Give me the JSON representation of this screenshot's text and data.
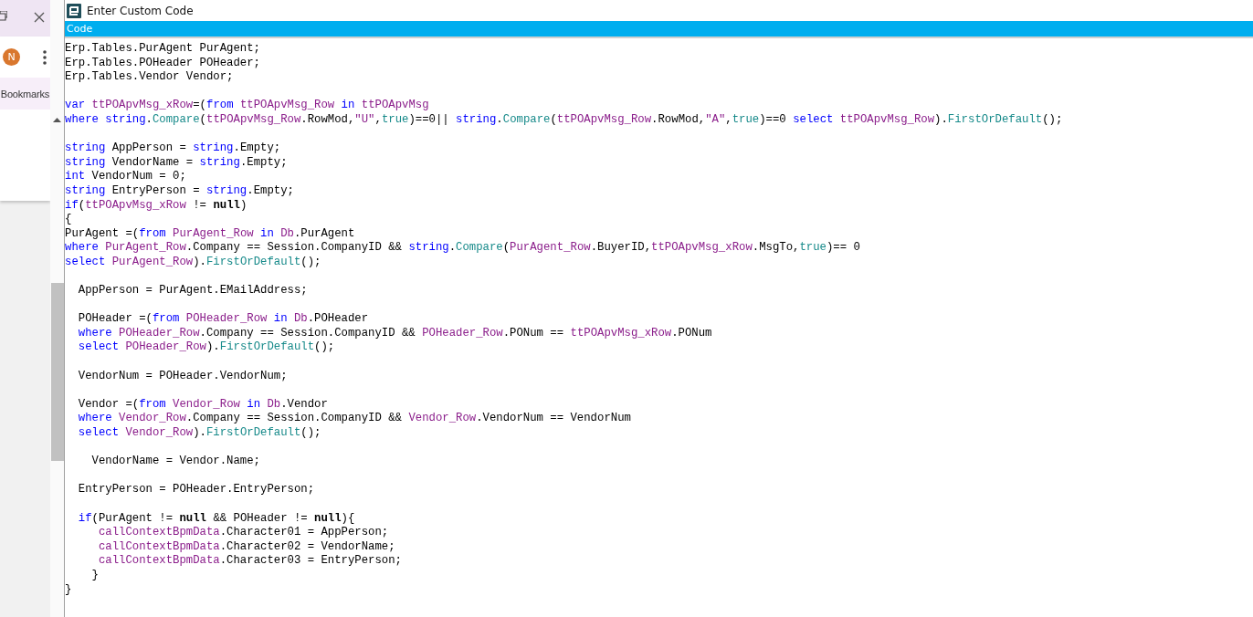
{
  "browser": {
    "avatar": "N",
    "bookmarks_label": "Bookmarks"
  },
  "window": {
    "title": "Enter Custom Code",
    "section": "Code"
  },
  "code_lines": [
    {
      "kind": "code",
      "tokens": [
        {
          "kind": "plain",
          "text": "Erp.Tables.PurAgent PurAgent;"
        }
      ]
    },
    {
      "kind": "code",
      "tokens": [
        {
          "kind": "plain",
          "text": "Erp.Tables.POHeader POHeader;"
        }
      ]
    },
    {
      "kind": "code",
      "tokens": [
        {
          "kind": "plain",
          "text": "Erp.Tables.Vendor Vendor;"
        }
      ]
    },
    {
      "kind": "blank"
    },
    {
      "kind": "code",
      "tokens": [
        {
          "kind": "keyword",
          "text": "var "
        },
        {
          "kind": "variable",
          "text": "ttPOApvMsg_xRow"
        },
        {
          "kind": "plain",
          "text": "=("
        },
        {
          "kind": "keyword",
          "text": "from "
        },
        {
          "kind": "variable",
          "text": "ttPOApvMsg_Row "
        },
        {
          "kind": "keyword",
          "text": "in "
        },
        {
          "kind": "variable",
          "text": "ttPOApvMsg"
        }
      ]
    },
    {
      "kind": "code",
      "tokens": [
        {
          "kind": "keyword",
          "text": "where string"
        },
        {
          "kind": "plain",
          "text": "."
        },
        {
          "kind": "method",
          "text": "Compare"
        },
        {
          "kind": "plain",
          "text": "("
        },
        {
          "kind": "variable",
          "text": "ttPOApvMsg_Row"
        },
        {
          "kind": "plain",
          "text": ".RowMod,"
        },
        {
          "kind": "variable",
          "text": "\"U\""
        },
        {
          "kind": "plain",
          "text": ","
        },
        {
          "kind": "method",
          "text": "true"
        },
        {
          "kind": "plain",
          "text": ")==0|| "
        },
        {
          "kind": "keyword",
          "text": "string"
        },
        {
          "kind": "plain",
          "text": "."
        },
        {
          "kind": "method",
          "text": "Compare"
        },
        {
          "kind": "plain",
          "text": "("
        },
        {
          "kind": "variable",
          "text": "ttPOApvMsg_Row"
        },
        {
          "kind": "plain",
          "text": ".RowMod,"
        },
        {
          "kind": "variable",
          "text": "\"A\""
        },
        {
          "kind": "plain",
          "text": ","
        },
        {
          "kind": "method",
          "text": "true"
        },
        {
          "kind": "plain",
          "text": ")==0 "
        },
        {
          "kind": "keyword",
          "text": "select "
        },
        {
          "kind": "variable",
          "text": "ttPOApvMsg_Row"
        },
        {
          "kind": "plain",
          "text": ")."
        },
        {
          "kind": "method",
          "text": "FirstOrDefault"
        },
        {
          "kind": "plain",
          "text": "();"
        }
      ]
    },
    {
      "kind": "blank"
    },
    {
      "kind": "code",
      "tokens": [
        {
          "kind": "keyword",
          "text": "string "
        },
        {
          "kind": "plain",
          "text": "AppPerson = "
        },
        {
          "kind": "keyword",
          "text": "string"
        },
        {
          "kind": "plain",
          "text": ".Empty;"
        }
      ]
    },
    {
      "kind": "code",
      "tokens": [
        {
          "kind": "keyword",
          "text": "string "
        },
        {
          "kind": "plain",
          "text": "VendorName = "
        },
        {
          "kind": "keyword",
          "text": "string"
        },
        {
          "kind": "plain",
          "text": ".Empty;"
        }
      ]
    },
    {
      "kind": "code",
      "tokens": [
        {
          "kind": "keyword",
          "text": "int "
        },
        {
          "kind": "plain",
          "text": "VendorNum = 0;"
        }
      ]
    },
    {
      "kind": "code",
      "tokens": [
        {
          "kind": "keyword",
          "text": "string "
        },
        {
          "kind": "plain",
          "text": "EntryPerson = "
        },
        {
          "kind": "keyword",
          "text": "string"
        },
        {
          "kind": "plain",
          "text": ".Empty;"
        }
      ]
    },
    {
      "kind": "code",
      "tokens": [
        {
          "kind": "keyword",
          "text": "if"
        },
        {
          "kind": "plain",
          "text": "("
        },
        {
          "kind": "variable",
          "text": "ttPOApvMsg_xRow"
        },
        {
          "kind": "plain",
          "text": " != "
        },
        {
          "kind": "bold",
          "text": "null"
        },
        {
          "kind": "plain",
          "text": ")"
        }
      ]
    },
    {
      "kind": "code",
      "tokens": [
        {
          "kind": "plain",
          "text": "{"
        }
      ]
    },
    {
      "kind": "code",
      "tokens": [
        {
          "kind": "plain",
          "text": "PurAgent =("
        },
        {
          "kind": "keyword",
          "text": "from "
        },
        {
          "kind": "variable",
          "text": "PurAgent_Row "
        },
        {
          "kind": "keyword",
          "text": "in "
        },
        {
          "kind": "variable",
          "text": "Db"
        },
        {
          "kind": "plain",
          "text": ".PurAgent"
        }
      ]
    },
    {
      "kind": "code",
      "tokens": [
        {
          "kind": "keyword",
          "text": "where "
        },
        {
          "kind": "variable",
          "text": "PurAgent_Row"
        },
        {
          "kind": "plain",
          "text": ".Company == Session.CompanyID && "
        },
        {
          "kind": "keyword",
          "text": "string"
        },
        {
          "kind": "plain",
          "text": "."
        },
        {
          "kind": "method",
          "text": "Compare"
        },
        {
          "kind": "plain",
          "text": "("
        },
        {
          "kind": "variable",
          "text": "PurAgent_Row"
        },
        {
          "kind": "plain",
          "text": ".BuyerID,"
        },
        {
          "kind": "variable",
          "text": "ttPOApvMsg_xRow"
        },
        {
          "kind": "plain",
          "text": ".MsgTo,"
        },
        {
          "kind": "method",
          "text": "true"
        },
        {
          "kind": "plain",
          "text": ")== 0"
        }
      ]
    },
    {
      "kind": "code",
      "tokens": [
        {
          "kind": "keyword",
          "text": "select "
        },
        {
          "kind": "variable",
          "text": "PurAgent_Row"
        },
        {
          "kind": "plain",
          "text": ")."
        },
        {
          "kind": "method",
          "text": "FirstOrDefault"
        },
        {
          "kind": "plain",
          "text": "();"
        }
      ]
    },
    {
      "kind": "blank"
    },
    {
      "kind": "code",
      "tokens": [
        {
          "kind": "plain",
          "text": "  AppPerson = PurAgent.EMailAddress;"
        }
      ]
    },
    {
      "kind": "blank"
    },
    {
      "kind": "code",
      "tokens": [
        {
          "kind": "plain",
          "text": "  POHeader =("
        },
        {
          "kind": "keyword",
          "text": "from "
        },
        {
          "kind": "variable",
          "text": "POHeader_Row "
        },
        {
          "kind": "keyword",
          "text": "in "
        },
        {
          "kind": "variable",
          "text": "Db"
        },
        {
          "kind": "plain",
          "text": ".POHeader"
        }
      ]
    },
    {
      "kind": "code",
      "tokens": [
        {
          "kind": "keyword",
          "text": "  where "
        },
        {
          "kind": "variable",
          "text": "POHeader_Row"
        },
        {
          "kind": "plain",
          "text": ".Company == Session.CompanyID && "
        },
        {
          "kind": "variable",
          "text": "POHeader_Row"
        },
        {
          "kind": "plain",
          "text": ".PONum == "
        },
        {
          "kind": "variable",
          "text": "ttPOApvMsg_xRow"
        },
        {
          "kind": "plain",
          "text": ".PONum"
        }
      ]
    },
    {
      "kind": "code",
      "tokens": [
        {
          "kind": "keyword",
          "text": "  select "
        },
        {
          "kind": "variable",
          "text": "POHeader_Row"
        },
        {
          "kind": "plain",
          "text": ")."
        },
        {
          "kind": "method",
          "text": "FirstOrDefault"
        },
        {
          "kind": "plain",
          "text": "();"
        }
      ]
    },
    {
      "kind": "blank"
    },
    {
      "kind": "code",
      "tokens": [
        {
          "kind": "plain",
          "text": "  VendorNum = POHeader.VendorNum;"
        }
      ]
    },
    {
      "kind": "blank"
    },
    {
      "kind": "code",
      "tokens": [
        {
          "kind": "plain",
          "text": "  Vendor =("
        },
        {
          "kind": "keyword",
          "text": "from "
        },
        {
          "kind": "variable",
          "text": "Vendor_Row "
        },
        {
          "kind": "keyword",
          "text": "in "
        },
        {
          "kind": "variable",
          "text": "Db"
        },
        {
          "kind": "plain",
          "text": ".Vendor"
        }
      ]
    },
    {
      "kind": "code",
      "tokens": [
        {
          "kind": "keyword",
          "text": "  where "
        },
        {
          "kind": "variable",
          "text": "Vendor_Row"
        },
        {
          "kind": "plain",
          "text": ".Company == Session.CompanyID && "
        },
        {
          "kind": "variable",
          "text": "Vendor_Row"
        },
        {
          "kind": "plain",
          "text": ".VendorNum == VendorNum"
        }
      ]
    },
    {
      "kind": "code",
      "tokens": [
        {
          "kind": "keyword",
          "text": "  select "
        },
        {
          "kind": "variable",
          "text": "Vendor_Row"
        },
        {
          "kind": "plain",
          "text": ")."
        },
        {
          "kind": "method",
          "text": "FirstOrDefault"
        },
        {
          "kind": "plain",
          "text": "();"
        }
      ]
    },
    {
      "kind": "blank"
    },
    {
      "kind": "code",
      "tokens": [
        {
          "kind": "plain",
          "text": "    VendorName = Vendor.Name;"
        }
      ]
    },
    {
      "kind": "blank"
    },
    {
      "kind": "code",
      "tokens": [
        {
          "kind": "plain",
          "text": "  EntryPerson = POHeader.EntryPerson;"
        }
      ]
    },
    {
      "kind": "blank"
    },
    {
      "kind": "code",
      "tokens": [
        {
          "kind": "keyword",
          "text": "  if"
        },
        {
          "kind": "plain",
          "text": "(PurAgent != "
        },
        {
          "kind": "bold",
          "text": "null"
        },
        {
          "kind": "plain",
          "text": " && POHeader != "
        },
        {
          "kind": "bold",
          "text": "null"
        },
        {
          "kind": "plain",
          "text": "){"
        }
      ]
    },
    {
      "kind": "code",
      "tokens": [
        {
          "kind": "variable",
          "text": "     callContextBpmData"
        },
        {
          "kind": "plain",
          "text": ".Character01 = AppPerson;"
        }
      ]
    },
    {
      "kind": "code",
      "tokens": [
        {
          "kind": "variable",
          "text": "     callContextBpmData"
        },
        {
          "kind": "plain",
          "text": ".Character02 = VendorName;"
        }
      ]
    },
    {
      "kind": "code",
      "tokens": [
        {
          "kind": "variable",
          "text": "     callContextBpmData"
        },
        {
          "kind": "plain",
          "text": ".Character03 = EntryPerson;"
        }
      ]
    },
    {
      "kind": "code",
      "tokens": [
        {
          "kind": "plain",
          "text": "    }"
        }
      ]
    },
    {
      "kind": "code",
      "tokens": [
        {
          "kind": "plain",
          "text": "}"
        }
      ]
    }
  ]
}
